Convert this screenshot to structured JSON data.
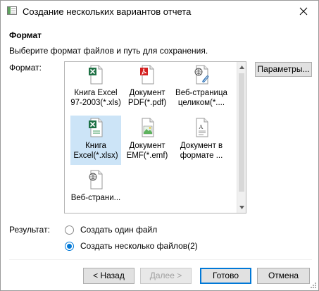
{
  "window": {
    "title": "Создание нескольких вариантов отчета"
  },
  "section": {
    "heading": "Формат",
    "hint": "Выберите формат файлов и путь для сохранения."
  },
  "format": {
    "label": "Формат:",
    "params_button": "Параметры...",
    "items": [
      {
        "line1": "Книга Excel",
        "line2": "97-2003(*.xls)",
        "icon": "excel-xls-icon"
      },
      {
        "line1": "Документ",
        "line2": "PDF(*.pdf)",
        "icon": "pdf-icon"
      },
      {
        "line1": "Веб-страница",
        "line2": "целиком(*....",
        "icon": "web-page-complete-icon"
      },
      {
        "line1": "Книга",
        "line2": "Excel(*.xlsx)",
        "icon": "excel-xlsx-icon",
        "selected": true
      },
      {
        "line1": "Документ",
        "line2": "EMF(*.emf)",
        "icon": "emf-icon"
      },
      {
        "line1": "Документ в",
        "line2": "формате ...",
        "icon": "text-document-icon"
      },
      {
        "line1": "Веб-страни...",
        "line2": "",
        "icon": "web-page-icon"
      }
    ]
  },
  "result": {
    "label": "Результат:",
    "options": [
      {
        "label": "Создать один файл",
        "checked": false
      },
      {
        "label": "Создать несколько файлов(2)",
        "checked": true
      }
    ]
  },
  "buttons": {
    "back": "< Назад",
    "next": "Далее >",
    "done": "Готово",
    "cancel": "Отмена"
  },
  "colors": {
    "accent": "#0078d7",
    "selection": "#cce4f7",
    "excel": "#1e7145",
    "pdf": "#d42020"
  }
}
